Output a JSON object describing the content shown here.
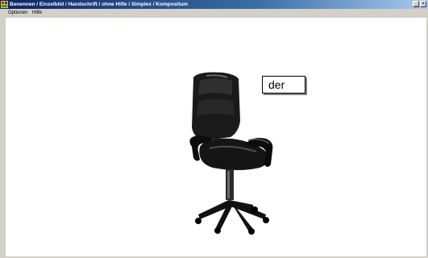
{
  "window": {
    "title": "Benennen / Einzelbild / Handschrift / ohne Hilfe / Simplex / Kompositum",
    "app_icon": "app-icon",
    "controls": {
      "minimize_icon": "minimize-icon",
      "close_icon": "close-icon"
    }
  },
  "menu": {
    "items": [
      {
        "label": "Optionen"
      },
      {
        "label": "Hilfe"
      }
    ]
  },
  "main": {
    "picture": "office-chair-image",
    "answer": {
      "text": "der"
    }
  },
  "colors": {
    "titlebar_start": "#0a246a",
    "titlebar_end": "#a6caf0",
    "client_background": "#ffffff",
    "chrome": "#d4d0c8"
  }
}
